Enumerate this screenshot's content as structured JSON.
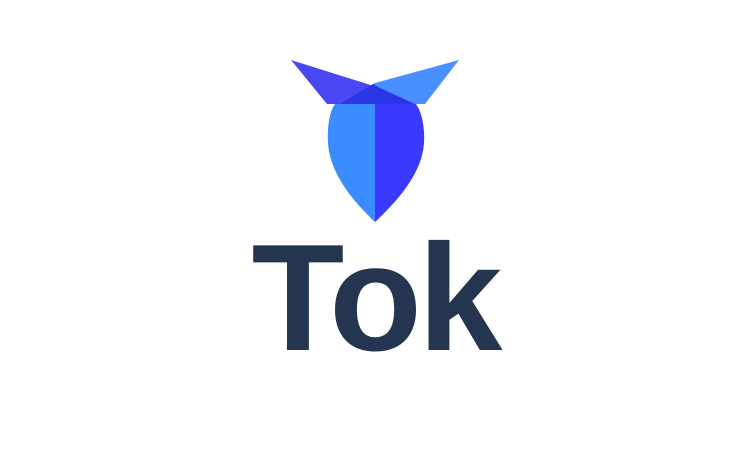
{
  "brand": {
    "name": "Tok",
    "logo_icon": "tok-bird-logo-icon",
    "colors": {
      "wordmark": "#253550",
      "blue_light": "#3a8cff",
      "blue_deep": "#3a3aff",
      "wing_left": "#3f3df2",
      "wing_right": "#3b86ff",
      "overlap": "#2a35e6",
      "background": "#ffffff"
    }
  }
}
